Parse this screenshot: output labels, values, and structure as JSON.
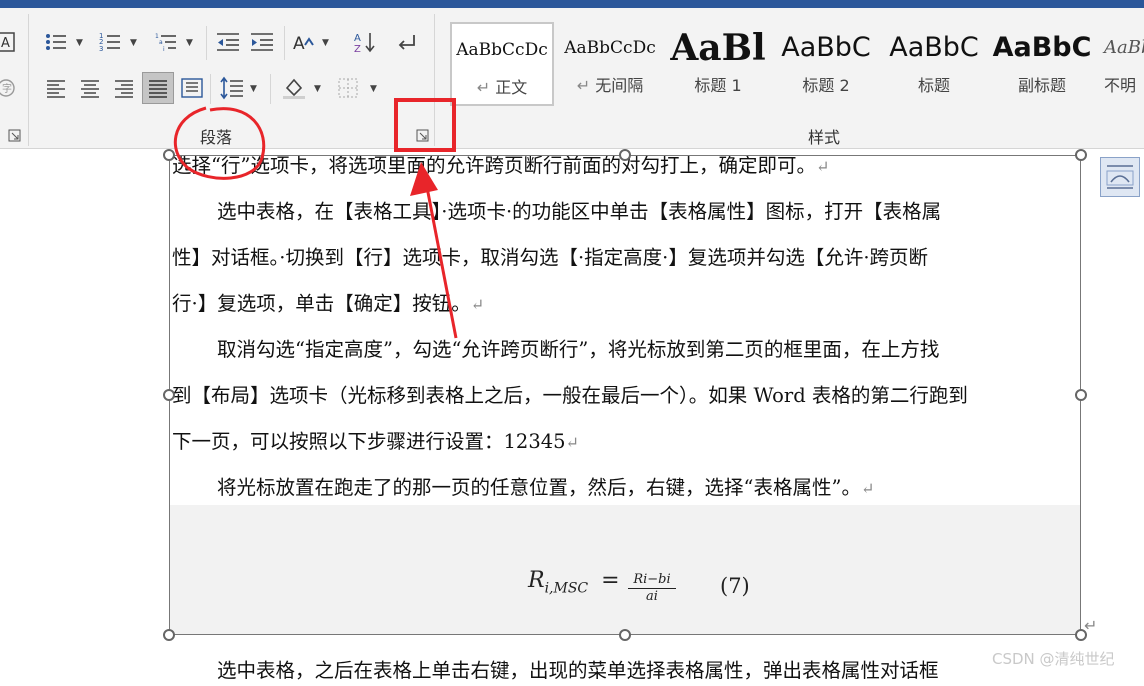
{
  "ribbon": {
    "paragraph_group_label": "段落",
    "styles_group_label": "样式",
    "styles": [
      {
        "preview": "AaBbCcDc",
        "label": "正文",
        "selected": true
      },
      {
        "preview": "AaBbCcDc",
        "label": "无间隔",
        "selected": false
      },
      {
        "preview": "AaBl",
        "label": "标题 1",
        "selected": false
      },
      {
        "preview": "AaBbC",
        "label": "标题 2",
        "selected": false
      },
      {
        "preview": "AaBbC",
        "label": "标题",
        "selected": false
      },
      {
        "preview": "AaBbC",
        "label": "副标题",
        "selected": false
      },
      {
        "preview": "AaBb",
        "label": "不明",
        "selected": false
      }
    ]
  },
  "document": {
    "paragraphs": [
      "选择“行”选项卡，将选项里面的允许跨页断行前面的对勾打上，确定即可。",
      "选中表格，在【表格工具】·选项卡·的功能区中单击【表格属性】图标，打开【表格属",
      "性】对话框。·切换到【行】选项卡，取消勾选【·指定高度·】复选项并勾选【允许·跨页断",
      "行·】复选项，单击【确定】按钮。",
      "取消勾选“指定高度”，勾选“允许跨页断行”，将光标放到第二页的框里面，在上方找",
      "到【布局】选项卡（光标移到表格上之后，一般在最后一个）。如果 Word 表格的第二行跑到",
      "下一页，可以按照以下步骤进行设置：12345",
      "将光标放置在跑走了的那一页的任意位置，然后，右键，选择“表格属性”。",
      "选中表格，之后在表格上单击右键，出现的菜单选择表格属性，弹出表格属性对话框"
    ],
    "paragraph_mark": "↵",
    "formula": {
      "lhs": "R",
      "lhs_sub": "i,MSC",
      "equals": "=",
      "numerator": "Ri−bi",
      "denominator": "ai",
      "number": "(7)"
    }
  },
  "watermark": "CSDN @清纯世纪",
  "annotations": {
    "circle_color": "#e8252a",
    "box_color": "#e8252a",
    "arrow_color": "#e8252a"
  }
}
